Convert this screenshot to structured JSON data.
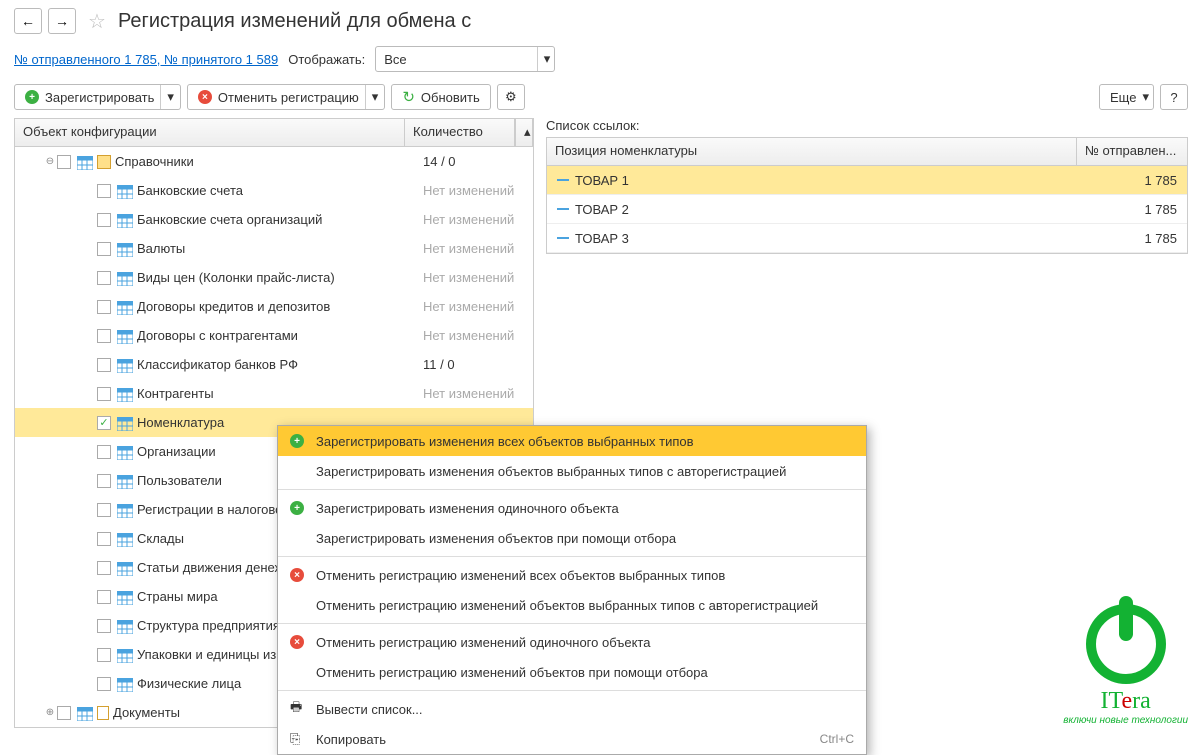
{
  "header": {
    "title": "Регистрация изменений для обмена с "
  },
  "subheader": {
    "link": "№ отправленного 1 785, № принятого 1 589",
    "display_label": "Отображать:",
    "display_value": "Все"
  },
  "toolbar": {
    "register": "Зарегистрировать",
    "cancel_reg": "Отменить регистрацию",
    "refresh": "Обновить",
    "more": "Еще",
    "help": "?"
  },
  "left": {
    "col_config": "Объект конфигурации",
    "col_count": "Количество",
    "no_changes": "Нет изменений",
    "tree": [
      {
        "level": 1,
        "name": "Справочники",
        "count": "14 / 0",
        "checked": false,
        "exp": "minus",
        "type": "cat"
      },
      {
        "level": 2,
        "name": "Банковские счета",
        "count": "Нет изменений",
        "gray": true,
        "type": "tbl"
      },
      {
        "level": 2,
        "name": "Банковские счета организаций",
        "count": "Нет изменений",
        "gray": true,
        "type": "tbl"
      },
      {
        "level": 2,
        "name": "Валюты",
        "count": "Нет изменений",
        "gray": true,
        "type": "tbl"
      },
      {
        "level": 2,
        "name": "Виды цен (Колонки прайс-листа)",
        "count": "Нет изменений",
        "gray": true,
        "type": "tbl"
      },
      {
        "level": 2,
        "name": "Договоры кредитов и депозитов",
        "count": "Нет изменений",
        "gray": true,
        "type": "tbl"
      },
      {
        "level": 2,
        "name": "Договоры с контрагентами",
        "count": "Нет изменений",
        "gray": true,
        "type": "tbl"
      },
      {
        "level": 2,
        "name": "Классификатор банков РФ",
        "count": "11 / 0",
        "type": "tbl"
      },
      {
        "level": 2,
        "name": "Контрагенты",
        "count": "Нет изменений",
        "gray": true,
        "type": "tbl"
      },
      {
        "level": 2,
        "name": "Номенклатура",
        "count": "",
        "selected": true,
        "checked": true,
        "type": "tbl"
      },
      {
        "level": 2,
        "name": "Организации",
        "count": "",
        "type": "tbl"
      },
      {
        "level": 2,
        "name": "Пользователи",
        "count": "",
        "type": "tbl"
      },
      {
        "level": 2,
        "name": "Регистрации в налогово",
        "count": "",
        "type": "tbl"
      },
      {
        "level": 2,
        "name": "Склады",
        "count": "",
        "type": "tbl"
      },
      {
        "level": 2,
        "name": "Статьи движения денеж",
        "count": "",
        "type": "tbl"
      },
      {
        "level": 2,
        "name": "Страны мира",
        "count": "",
        "type": "tbl"
      },
      {
        "level": 2,
        "name": "Структура предприятия",
        "count": "",
        "type": "tbl"
      },
      {
        "level": 2,
        "name": "Упаковки и единицы из",
        "count": "",
        "type": "tbl"
      },
      {
        "level": 2,
        "name": "Физические лица",
        "count": "",
        "type": "tbl"
      },
      {
        "level": 1,
        "name": "Документы",
        "exp": "plus",
        "type": "doc"
      }
    ]
  },
  "right": {
    "title": "Список ссылок:",
    "col_pos": "Позиция номенклатуры",
    "col_num": "№ отправлен...",
    "rows": [
      {
        "name": "ТОВАР 1",
        "num": "1 785",
        "sel": true
      },
      {
        "name": "ТОВАР 2",
        "num": "1 785"
      },
      {
        "name": "ТОВАР 3",
        "num": "1 785"
      }
    ]
  },
  "menu": {
    "items": [
      {
        "text": "Зарегистрировать изменения всех объектов выбранных типов",
        "icon": "plus",
        "hl": true
      },
      {
        "text": "Зарегистрировать изменения объектов выбранных типов с авторегистрацией"
      },
      {
        "sep": true
      },
      {
        "text": "Зарегистрировать изменения одиночного объекта",
        "icon": "plus"
      },
      {
        "text": "Зарегистрировать изменения объектов при помощи отбора"
      },
      {
        "sep": true
      },
      {
        "text": "Отменить регистрацию изменений всех объектов выбранных типов",
        "icon": "cross"
      },
      {
        "text": "Отменить регистрацию изменений объектов выбранных типов с авторегистрацией"
      },
      {
        "sep": true
      },
      {
        "text": "Отменить регистрацию изменений одиночного объекта",
        "icon": "cross"
      },
      {
        "text": "Отменить регистрацию изменений объектов при помощи отбора"
      },
      {
        "sep": true
      },
      {
        "text": "Вывести список...",
        "icon": "print"
      },
      {
        "text": "Копировать",
        "icon": "copy",
        "short": "Ctrl+C"
      }
    ]
  },
  "logo": {
    "name": "ITera",
    "sub": "включи новые технологии"
  }
}
